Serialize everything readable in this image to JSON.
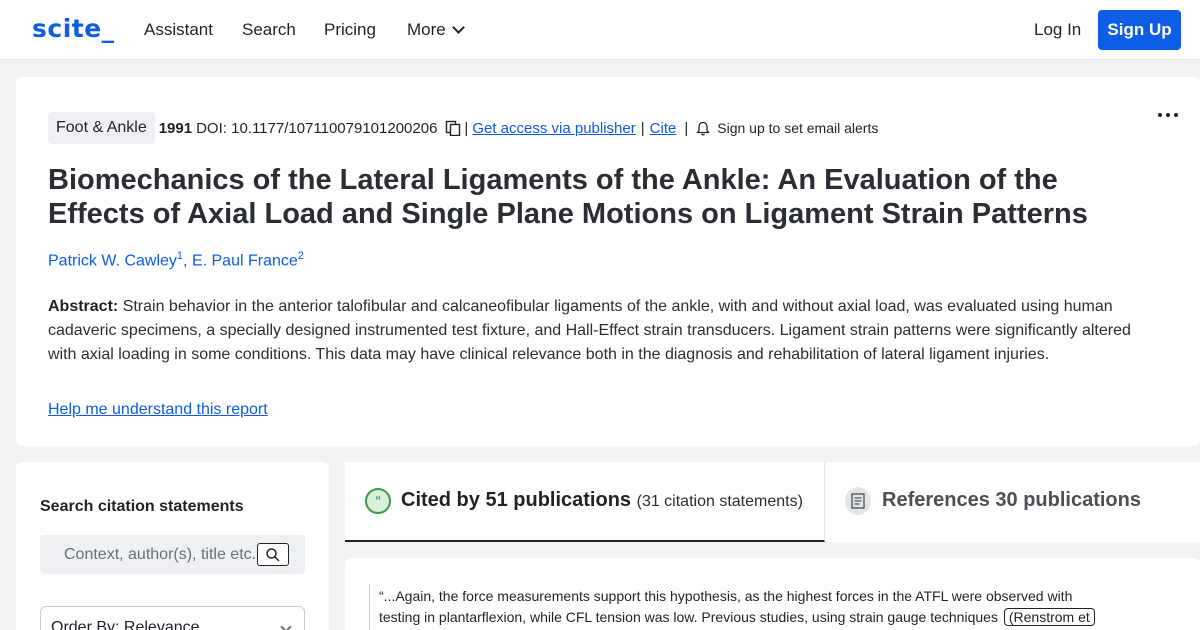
{
  "nav": {
    "logo": "scite_",
    "links": [
      "Assistant",
      "Search",
      "Pricing",
      "More"
    ],
    "login": "Log In",
    "signup": "Sign Up"
  },
  "paper": {
    "journal": "Foot & Ankle",
    "year": "1991",
    "doi": "DOI: 10.1177/107110079101200206",
    "access_link": "Get access via publisher",
    "cite_link": "Cite",
    "alerts": "Sign up to set email alerts",
    "title": "Biomechanics of the Lateral Ligaments of the Ankle: An Evaluation of the Effects of Axial Load and Single Plane Motions on Ligament Strain Patterns",
    "authors": [
      {
        "name": "Patrick W. Cawley",
        "aff": "1"
      },
      {
        "name": "E. Paul France",
        "aff": "2"
      }
    ],
    "abstract_label": "Abstract:",
    "abstract": "Strain behavior in the anterior talofibular and calcaneofibular ligaments of the ankle, with and without axial load, was evaluated using human cadaveric specimens, a specially designed instrumented test fixture, and Hall-Effect strain transducers. Ligament strain patterns were significantly altered with axial loading in some conditions. This data may have clinical relevance both in the diagnosis and rehabilitation of lateral ligament injuries.",
    "help_link": "Help me understand this report"
  },
  "sidebar": {
    "title": "Search citation statements",
    "search_placeholder": "Context, author(s), title etc.",
    "order_by": "Order By: Relevance"
  },
  "tabs": {
    "cited_title": "Cited by 51 publications",
    "cited_sub": "(31 citation statements)",
    "refs_title": "References 30 publications"
  },
  "citation": {
    "text": "“...Again, the force measurements support this hypothesis, as the highest forces in the ATFL were observed with testing in plantarflexion, while CFL tension was low. Previous studies, using strain gauge techniques",
    "ref": "(Renstrom et"
  },
  "colors": {
    "brand": "#0d5de6",
    "supporting": "#3b9a4a"
  }
}
